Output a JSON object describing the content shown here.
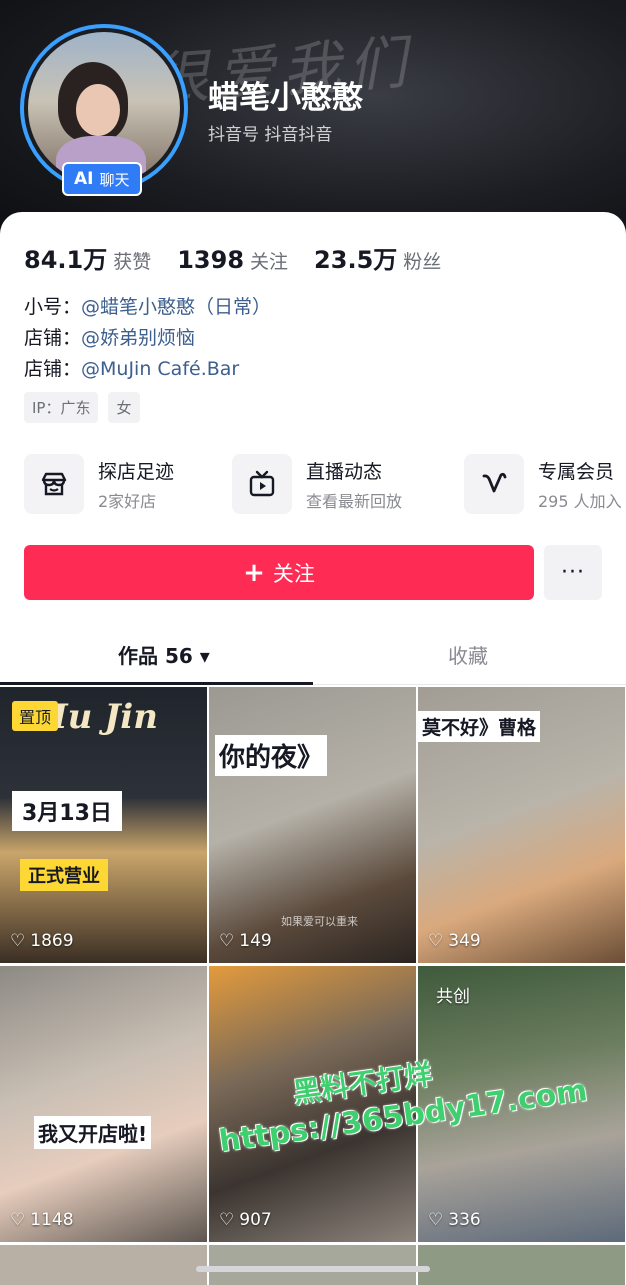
{
  "header": {
    "nickname": "蜡笔小憨憨",
    "douyin_id": "抖音号 抖音抖音",
    "ai_badge": {
      "ai": "AI",
      "label": "聊天"
    },
    "banner_text": "很爱我们"
  },
  "stats": [
    {
      "num": "84.1万",
      "label": "获赞"
    },
    {
      "num": "1398",
      "label": "关注"
    },
    {
      "num": "23.5万",
      "label": "粉丝"
    }
  ],
  "bio": [
    {
      "prefix": "小号：",
      "handle": "@蜡笔小憨憨（日常）"
    },
    {
      "prefix": "店铺：",
      "handle": "@娇弟别烦恼"
    },
    {
      "prefix": "店铺：",
      "handle": "@MuJin Café.Bar"
    }
  ],
  "tags": [
    "IP：广东",
    "女"
  ],
  "features": [
    {
      "title": "探店足迹",
      "sub": "2家好店",
      "icon": "shop-icon"
    },
    {
      "title": "直播动态",
      "sub": "查看最新回放",
      "icon": "tv-icon"
    },
    {
      "title": "专属会员",
      "sub": "295 人加入",
      "icon": "member-v-icon"
    }
  ],
  "actions": {
    "follow_plus": "+",
    "follow": "关注",
    "more": "···"
  },
  "tabs": {
    "works": "作品 56",
    "works_caret": "▾",
    "favorites": "收藏"
  },
  "videos": [
    {
      "likes": "1869",
      "pin": "置顶",
      "captions": [
        "Mu Jin",
        "3月13日",
        "正式营业"
      ]
    },
    {
      "likes": "149",
      "captions": [
        "你的夜》",
        "如果爱可以重来"
      ]
    },
    {
      "likes": "349",
      "captions": [
        "莫不好》曹格"
      ]
    },
    {
      "likes": "1148",
      "captions": [
        "我又开店啦!"
      ]
    },
    {
      "likes": "907",
      "captions": []
    },
    {
      "likes": "336",
      "collab": "共创",
      "captions": []
    }
  ],
  "watermark": {
    "line1": "黑料不打烊",
    "line2": "https://365bdy17.com"
  },
  "colors": {
    "accent": "#fe2c55",
    "link": "#3d5f8f",
    "badge": "#2f7cf6",
    "watermark": "#3ecf6f"
  }
}
